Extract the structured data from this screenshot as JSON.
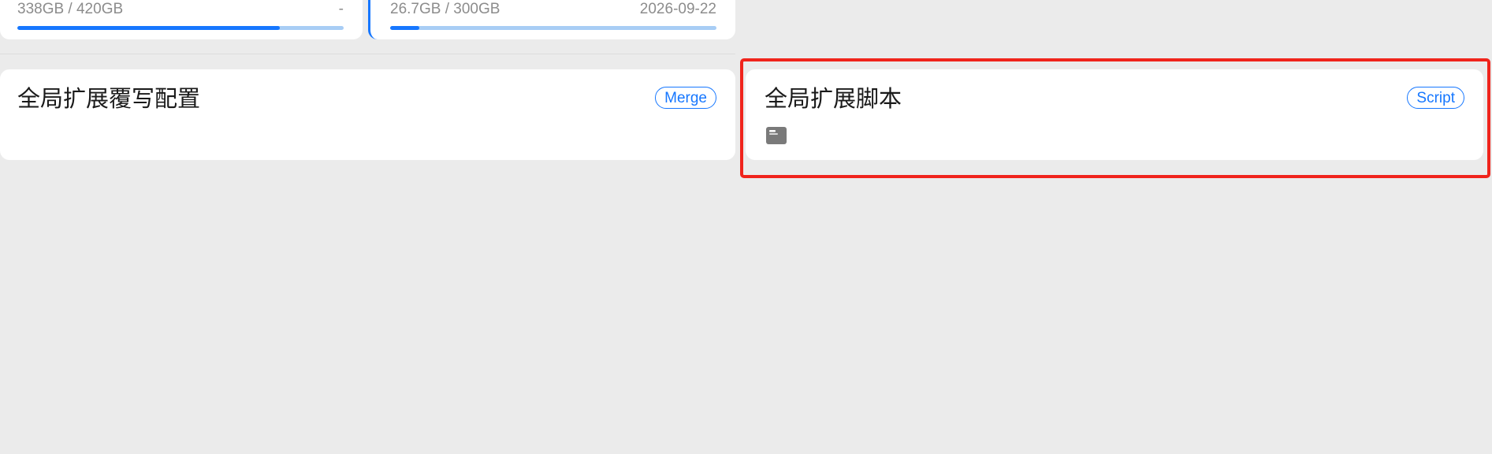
{
  "profiles": [
    {
      "usage": "338GB / 420GB",
      "expiry": "-",
      "progress": 0.805
    },
    {
      "usage": "26.7GB / 300GB",
      "expiry": "2026-09-22",
      "progress": 0.089
    }
  ],
  "global_merge": {
    "title": "全局扩展覆写配置",
    "badge": "Merge"
  },
  "global_script": {
    "title": "全局扩展脚本",
    "badge": "Script",
    "icon": "script-file-icon"
  },
  "colors": {
    "accent": "#1677ff",
    "progress_track": "#a8cdf5",
    "highlight": "#f0241c",
    "background": "#ebebeb"
  }
}
